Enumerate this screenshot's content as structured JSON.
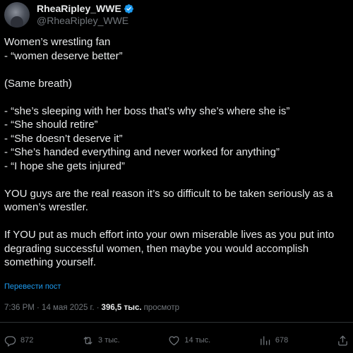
{
  "author": {
    "display_name": "RheaRipley_WWE",
    "handle": "@RheaRipley_WWE",
    "verified_color": "#1d9bf0"
  },
  "tweet": {
    "lines": [
      "Women’s wrestling fan",
      "- “women deserve better”",
      "",
      "(Same breath)",
      "",
      "- “she’s sleeping with her boss that’s why she’s where she is”",
      "- “She should retire”",
      "- “She doesn’t deserve it”",
      "- “She’s handed everything and never worked for anything”",
      "- “I hope she gets injured”",
      "",
      "YOU guys are the real reason it’s so difficult to be taken seriously as a women’s wrestler.",
      "",
      "If YOU put as much effort into your own miserable lives as you put into degrading successful women, then maybe you would accomplish something yourself."
    ],
    "translate_label": "Перевести пост"
  },
  "meta": {
    "time_date": "7:36 PM · 14 мая 2025 г. ·",
    "views_count": "396,5 тыс.",
    "views_label": "просмотр"
  },
  "actions": {
    "replies": "872",
    "reposts": "3 тыс.",
    "likes": "14 тыс.",
    "bookmarks": "678"
  },
  "icons": {
    "reply": "reply-icon",
    "repost": "repost-icon",
    "like": "heart-icon",
    "bookmark": "bookmark-icon",
    "share": "share-icon",
    "verified": "verified-badge-icon"
  }
}
